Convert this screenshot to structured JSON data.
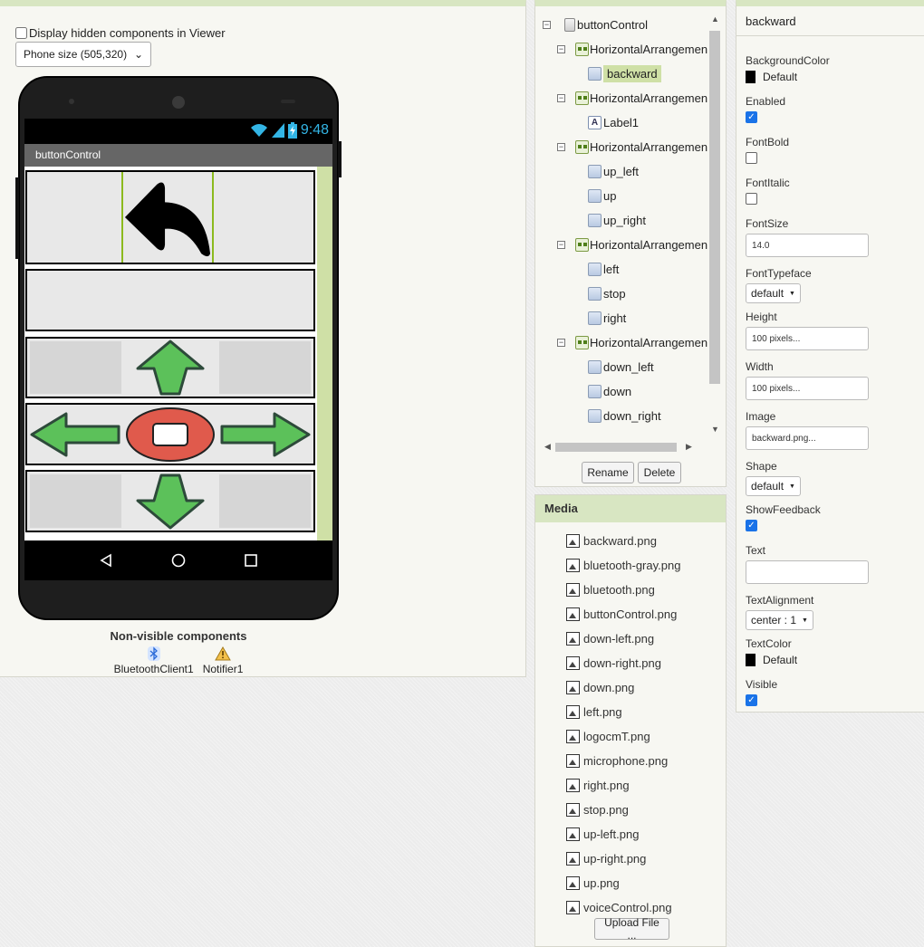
{
  "viewer": {
    "hidden_components_label": "Display hidden components in Viewer",
    "phone_size": "Phone size (505,320)",
    "status_time": "9:48",
    "app_title": "buttonControl",
    "nonvisible_title": "Non-visible components",
    "nonvisible": [
      {
        "name": "BluetoothClient1",
        "icon": "bluetooth-icon"
      },
      {
        "name": "Notifier1",
        "icon": "warning-icon"
      }
    ]
  },
  "components": {
    "tree": [
      {
        "label": "buttonControl",
        "type": "screen"
      },
      {
        "label": "HorizontalArrangemen",
        "type": "harr"
      },
      {
        "label": "backward",
        "type": "button",
        "selected": true
      },
      {
        "label": "HorizontalArrangemen",
        "type": "harr"
      },
      {
        "label": "Label1",
        "type": "label"
      },
      {
        "label": "HorizontalArrangemen",
        "type": "harr"
      },
      {
        "label": "up_left",
        "type": "button"
      },
      {
        "label": "up",
        "type": "button"
      },
      {
        "label": "up_right",
        "type": "button"
      },
      {
        "label": "HorizontalArrangemen",
        "type": "harr"
      },
      {
        "label": "left",
        "type": "button"
      },
      {
        "label": "stop",
        "type": "button"
      },
      {
        "label": "right",
        "type": "button"
      },
      {
        "label": "HorizontalArrangemen",
        "type": "harr"
      },
      {
        "label": "down_left",
        "type": "button"
      },
      {
        "label": "down",
        "type": "button"
      },
      {
        "label": "down_right",
        "type": "button"
      }
    ],
    "rename_label": "Rename",
    "delete_label": "Delete"
  },
  "media": {
    "title": "Media",
    "files": [
      "backward.png",
      "bluetooth-gray.png",
      "bluetooth.png",
      "buttonControl.png",
      "down-left.png",
      "down-right.png",
      "down.png",
      "left.png",
      "logocmT.png",
      "microphone.png",
      "right.png",
      "stop.png",
      "up-left.png",
      "up-right.png",
      "up.png",
      "voiceControl.png"
    ],
    "upload_label": "Upload File ..."
  },
  "properties": {
    "component": "backward",
    "background_color": {
      "label": "BackgroundColor",
      "value": "Default",
      "swatch": "#000000"
    },
    "enabled": {
      "label": "Enabled",
      "checked": true
    },
    "font_bold": {
      "label": "FontBold",
      "checked": false
    },
    "font_italic": {
      "label": "FontItalic",
      "checked": false
    },
    "font_size": {
      "label": "FontSize",
      "value": "14.0"
    },
    "font_typeface": {
      "label": "FontTypeface",
      "value": "default"
    },
    "height": {
      "label": "Height",
      "value": "100 pixels..."
    },
    "width": {
      "label": "Width",
      "value": "100 pixels..."
    },
    "image": {
      "label": "Image",
      "value": "backward.png..."
    },
    "shape": {
      "label": "Shape",
      "value": "default"
    },
    "show_feedback": {
      "label": "ShowFeedback",
      "checked": true
    },
    "text": {
      "label": "Text",
      "value": ""
    },
    "text_alignment": {
      "label": "TextAlignment",
      "value": "center : 1"
    },
    "text_color": {
      "label": "TextColor",
      "value": "Default",
      "swatch": "#000000"
    },
    "visible": {
      "label": "Visible",
      "checked": true
    }
  },
  "colors": {
    "accent_green": "#d8e6c2",
    "arrow_green": "#5cc15a",
    "stop_red": "#e05a4c",
    "check_blue": "#1a73e8"
  }
}
